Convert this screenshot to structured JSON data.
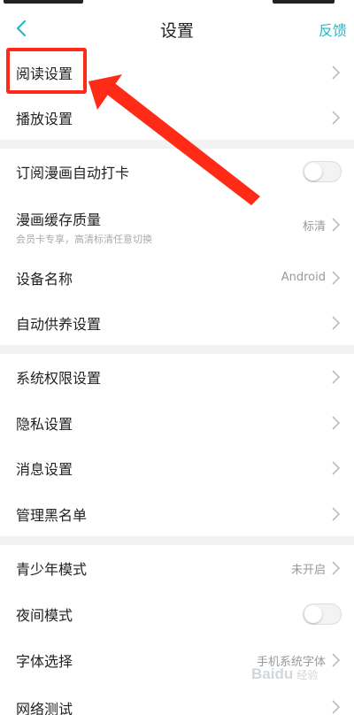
{
  "nav": {
    "title": "设置",
    "feedback": "反馈"
  },
  "rows": {
    "reading": "阅读设置",
    "playback": "播放设置",
    "subscribe_checkin": "订阅漫画自动打卡",
    "cache_quality": "漫画缓存质量",
    "cache_quality_sub": "会员卡专享，高清标清任意切换",
    "cache_quality_value": "标清",
    "device_name": "设备名称",
    "device_name_value": "Android",
    "auto_supply": "自动供养设置",
    "system_permissions": "系统权限设置",
    "privacy": "隐私设置",
    "messages": "消息设置",
    "blacklist": "管理黑名单",
    "teen_mode": "青少年模式",
    "teen_mode_value": "未开启",
    "night_mode": "夜间模式",
    "font": "字体选择",
    "font_value": "手机系统字体",
    "network_test": "网络测试"
  },
  "toggles": {
    "subscribe_checkin": false,
    "night_mode": false
  },
  "watermark": {
    "text": "Baidu",
    "sub": "经验"
  },
  "colors": {
    "accent": "#2bb6c6",
    "annotation": "#ff2b17",
    "divider": "#f2f2f2"
  }
}
